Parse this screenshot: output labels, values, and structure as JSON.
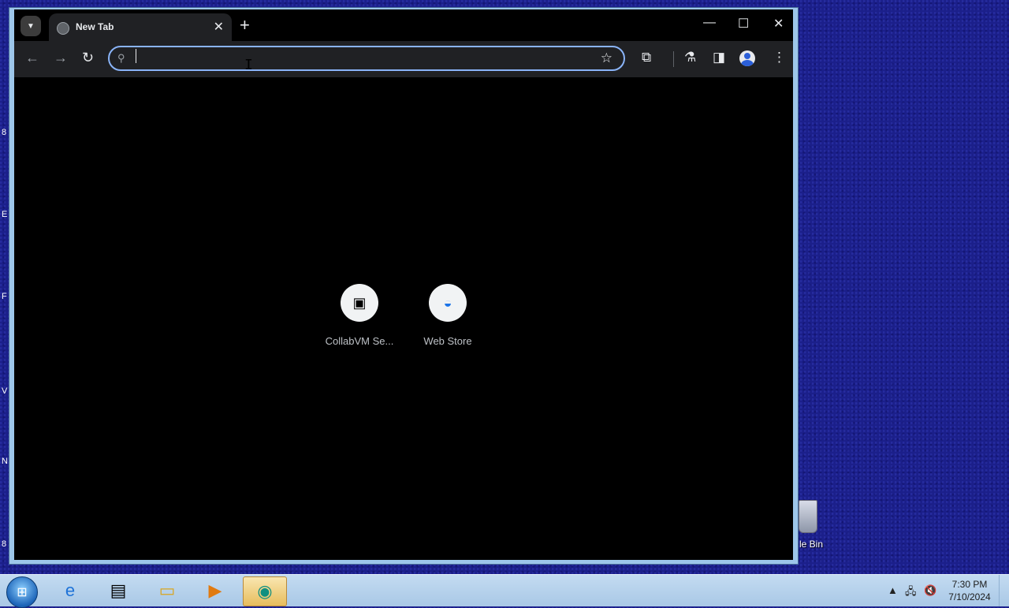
{
  "desktop": {
    "recycle_bin_label": "le Bin",
    "edge_glyphs": [
      "8",
      "E",
      "F",
      "V",
      "N",
      "8"
    ]
  },
  "browser": {
    "tab": {
      "title": "New Tab",
      "close": "✕"
    },
    "new_tab_glyph": "+",
    "window_controls": {
      "minimize": "—",
      "maximize": "☐",
      "close": "✕"
    },
    "nav": {
      "back": "←",
      "forward": "→",
      "reload": "↻"
    },
    "omnibox": {
      "value": "",
      "placeholder": ""
    },
    "shortcuts": [
      {
        "label": "CollabVM Se...",
        "icon": "collabvm-icon"
      },
      {
        "label": "Web Store",
        "icon": "web-store-icon"
      }
    ]
  },
  "taskbar": {
    "apps": [
      {
        "name": "internet-explorer",
        "glyph": "e"
      },
      {
        "name": "notepad",
        "glyph": "▤"
      },
      {
        "name": "file-explorer",
        "glyph": "▭"
      },
      {
        "name": "media-player",
        "glyph": "▶"
      },
      {
        "name": "chromium",
        "glyph": "◉"
      }
    ],
    "clock": {
      "time": "7:30 PM",
      "date": "7/10/2024"
    }
  }
}
